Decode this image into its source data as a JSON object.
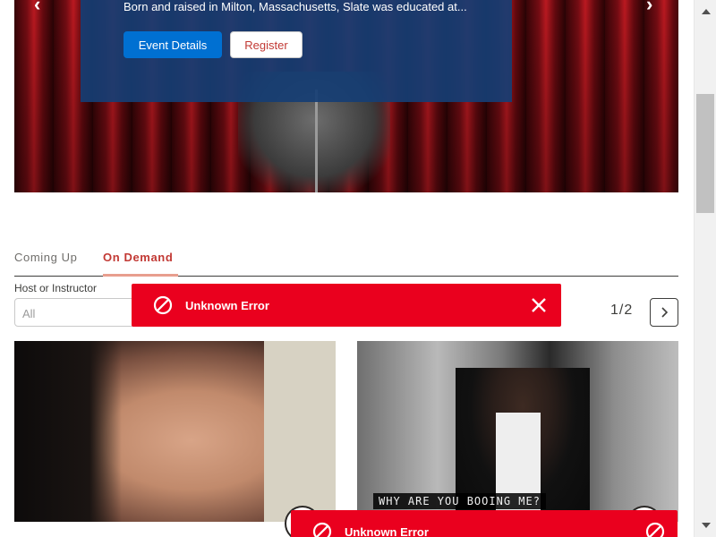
{
  "hero": {
    "description": "Born and raised in Milton, Massachusetts, Slate was educated at...",
    "event_details_label": "Event Details",
    "register_label": "Register",
    "prev_glyph": "‹",
    "next_glyph": "›"
  },
  "tabs": [
    {
      "label": "Coming Up",
      "active": false
    },
    {
      "label": "On Demand",
      "active": true
    }
  ],
  "filter": {
    "label": "Host or Instructor",
    "value": "All"
  },
  "pagination": {
    "text": "1/2"
  },
  "cards": [
    {
      "caption": ""
    },
    {
      "caption": "WHY ARE YOU BOOING ME?"
    }
  ],
  "toasts": [
    {
      "message": "Unknown Error",
      "icon": "ban-icon"
    },
    {
      "message": "Unknown Error",
      "icon": "ban-icon"
    }
  ],
  "colors": {
    "primary": "#0070d2",
    "accent": "#c23934",
    "error": "#ea001e",
    "panel": "#163e74"
  }
}
